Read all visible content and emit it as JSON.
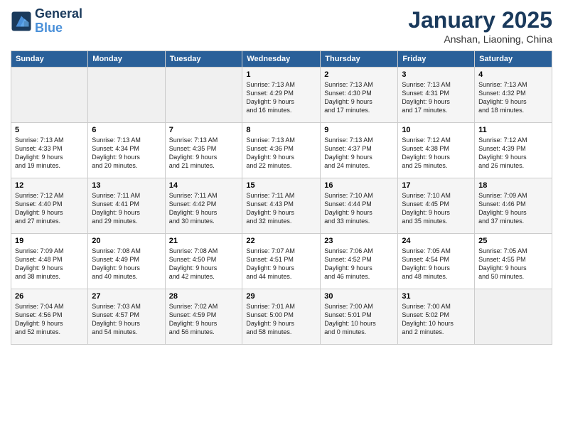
{
  "header": {
    "logo_line1": "General",
    "logo_line2": "Blue",
    "month": "January 2025",
    "location": "Anshan, Liaoning, China"
  },
  "weekdays": [
    "Sunday",
    "Monday",
    "Tuesday",
    "Wednesday",
    "Thursday",
    "Friday",
    "Saturday"
  ],
  "weeks": [
    [
      {
        "day": "",
        "info": ""
      },
      {
        "day": "",
        "info": ""
      },
      {
        "day": "",
        "info": ""
      },
      {
        "day": "1",
        "info": "Sunrise: 7:13 AM\nSunset: 4:29 PM\nDaylight: 9 hours\nand 16 minutes."
      },
      {
        "day": "2",
        "info": "Sunrise: 7:13 AM\nSunset: 4:30 PM\nDaylight: 9 hours\nand 17 minutes."
      },
      {
        "day": "3",
        "info": "Sunrise: 7:13 AM\nSunset: 4:31 PM\nDaylight: 9 hours\nand 17 minutes."
      },
      {
        "day": "4",
        "info": "Sunrise: 7:13 AM\nSunset: 4:32 PM\nDaylight: 9 hours\nand 18 minutes."
      }
    ],
    [
      {
        "day": "5",
        "info": "Sunrise: 7:13 AM\nSunset: 4:33 PM\nDaylight: 9 hours\nand 19 minutes."
      },
      {
        "day": "6",
        "info": "Sunrise: 7:13 AM\nSunset: 4:34 PM\nDaylight: 9 hours\nand 20 minutes."
      },
      {
        "day": "7",
        "info": "Sunrise: 7:13 AM\nSunset: 4:35 PM\nDaylight: 9 hours\nand 21 minutes."
      },
      {
        "day": "8",
        "info": "Sunrise: 7:13 AM\nSunset: 4:36 PM\nDaylight: 9 hours\nand 22 minutes."
      },
      {
        "day": "9",
        "info": "Sunrise: 7:13 AM\nSunset: 4:37 PM\nDaylight: 9 hours\nand 24 minutes."
      },
      {
        "day": "10",
        "info": "Sunrise: 7:12 AM\nSunset: 4:38 PM\nDaylight: 9 hours\nand 25 minutes."
      },
      {
        "day": "11",
        "info": "Sunrise: 7:12 AM\nSunset: 4:39 PM\nDaylight: 9 hours\nand 26 minutes."
      }
    ],
    [
      {
        "day": "12",
        "info": "Sunrise: 7:12 AM\nSunset: 4:40 PM\nDaylight: 9 hours\nand 27 minutes."
      },
      {
        "day": "13",
        "info": "Sunrise: 7:11 AM\nSunset: 4:41 PM\nDaylight: 9 hours\nand 29 minutes."
      },
      {
        "day": "14",
        "info": "Sunrise: 7:11 AM\nSunset: 4:42 PM\nDaylight: 9 hours\nand 30 minutes."
      },
      {
        "day": "15",
        "info": "Sunrise: 7:11 AM\nSunset: 4:43 PM\nDaylight: 9 hours\nand 32 minutes."
      },
      {
        "day": "16",
        "info": "Sunrise: 7:10 AM\nSunset: 4:44 PM\nDaylight: 9 hours\nand 33 minutes."
      },
      {
        "day": "17",
        "info": "Sunrise: 7:10 AM\nSunset: 4:45 PM\nDaylight: 9 hours\nand 35 minutes."
      },
      {
        "day": "18",
        "info": "Sunrise: 7:09 AM\nSunset: 4:46 PM\nDaylight: 9 hours\nand 37 minutes."
      }
    ],
    [
      {
        "day": "19",
        "info": "Sunrise: 7:09 AM\nSunset: 4:48 PM\nDaylight: 9 hours\nand 38 minutes."
      },
      {
        "day": "20",
        "info": "Sunrise: 7:08 AM\nSunset: 4:49 PM\nDaylight: 9 hours\nand 40 minutes."
      },
      {
        "day": "21",
        "info": "Sunrise: 7:08 AM\nSunset: 4:50 PM\nDaylight: 9 hours\nand 42 minutes."
      },
      {
        "day": "22",
        "info": "Sunrise: 7:07 AM\nSunset: 4:51 PM\nDaylight: 9 hours\nand 44 minutes."
      },
      {
        "day": "23",
        "info": "Sunrise: 7:06 AM\nSunset: 4:52 PM\nDaylight: 9 hours\nand 46 minutes."
      },
      {
        "day": "24",
        "info": "Sunrise: 7:05 AM\nSunset: 4:54 PM\nDaylight: 9 hours\nand 48 minutes."
      },
      {
        "day": "25",
        "info": "Sunrise: 7:05 AM\nSunset: 4:55 PM\nDaylight: 9 hours\nand 50 minutes."
      }
    ],
    [
      {
        "day": "26",
        "info": "Sunrise: 7:04 AM\nSunset: 4:56 PM\nDaylight: 9 hours\nand 52 minutes."
      },
      {
        "day": "27",
        "info": "Sunrise: 7:03 AM\nSunset: 4:57 PM\nDaylight: 9 hours\nand 54 minutes."
      },
      {
        "day": "28",
        "info": "Sunrise: 7:02 AM\nSunset: 4:59 PM\nDaylight: 9 hours\nand 56 minutes."
      },
      {
        "day": "29",
        "info": "Sunrise: 7:01 AM\nSunset: 5:00 PM\nDaylight: 9 hours\nand 58 minutes."
      },
      {
        "day": "30",
        "info": "Sunrise: 7:00 AM\nSunset: 5:01 PM\nDaylight: 10 hours\nand 0 minutes."
      },
      {
        "day": "31",
        "info": "Sunrise: 7:00 AM\nSunset: 5:02 PM\nDaylight: 10 hours\nand 2 minutes."
      },
      {
        "day": "",
        "info": ""
      }
    ]
  ]
}
